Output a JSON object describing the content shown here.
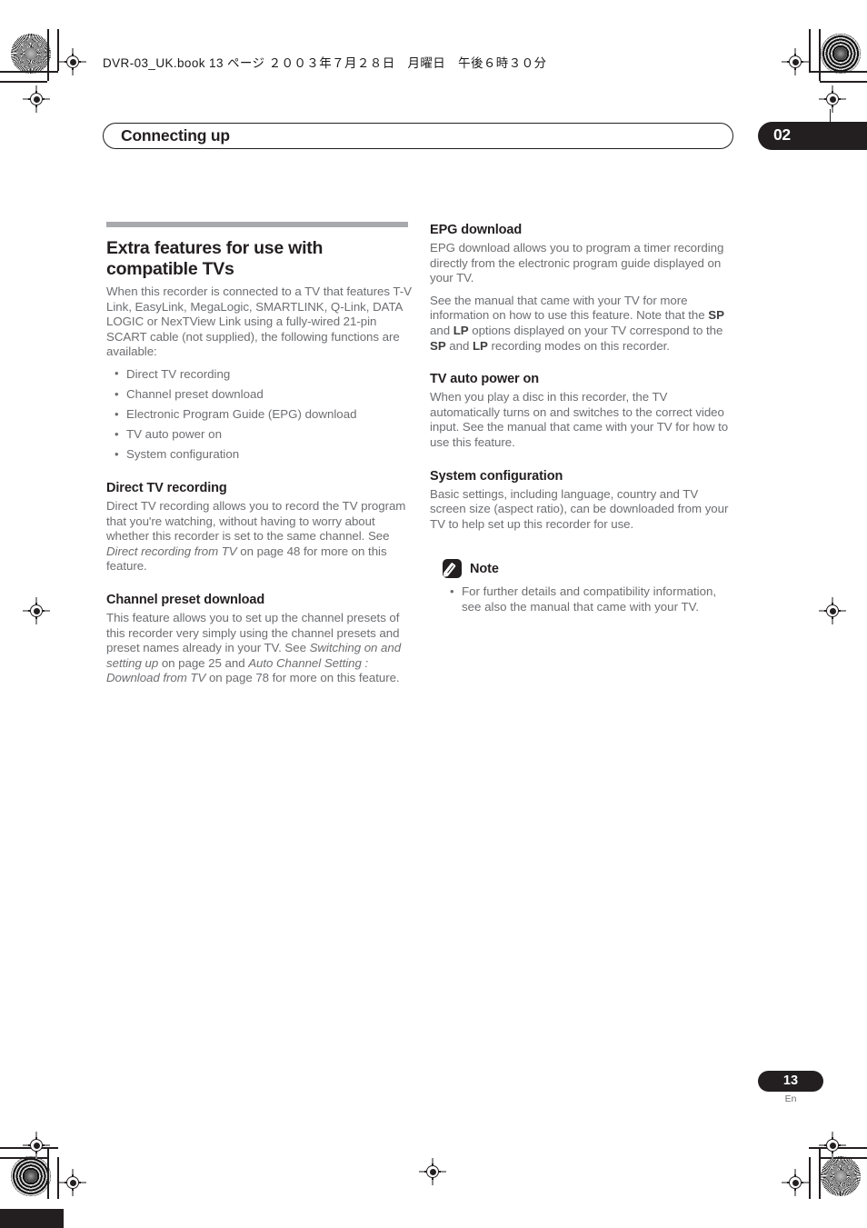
{
  "print_marks": {
    "book_line": "DVR-03_UK.book 13 ページ ２００３年７月２８日　月曜日　午後６時３０分"
  },
  "header": {
    "title": "Connecting up",
    "chapter_number": "02"
  },
  "left_column": {
    "title": "Extra features for use with compatible TVs",
    "intro": "When this recorder is connected to a TV that features T-V Link, EasyLink, MegaLogic, SMARTLINK, Q-Link, DATA LOGIC or NexTView Link using a fully-wired 21-pin SCART cable (not supplied), the following functions are available:",
    "bullets": [
      "Direct TV recording",
      "Channel preset download",
      "Electronic Program Guide (EPG) download",
      "TV auto power on",
      "System configuration"
    ],
    "sections": [
      {
        "heading": "Direct TV recording",
        "body_parts": [
          {
            "text": "Direct TV recording allows you to record the TV program that you're watching, without having to worry about whether this recorder is set to the same channel. See ",
            "style": "normal"
          },
          {
            "text": "Direct recording from TV",
            "style": "italic"
          },
          {
            "text": " on page 48 for more on this feature.",
            "style": "normal"
          }
        ]
      },
      {
        "heading": "Channel preset download",
        "body_parts": [
          {
            "text": "This feature allows you to set up the channel presets of this recorder very simply using the channel presets and preset names already in your TV. See ",
            "style": "normal"
          },
          {
            "text": "Switching on and setting up",
            "style": "italic"
          },
          {
            "text": " on page 25 and ",
            "style": "normal"
          },
          {
            "text": "Auto Channel Setting : Download from TV",
            "style": "italic"
          },
          {
            "text": " on page 78 for more on this feature.",
            "style": "normal"
          }
        ]
      }
    ]
  },
  "right_column": {
    "sections": [
      {
        "heading": "EPG download",
        "paragraphs": [
          [
            {
              "text": "EPG download allows you to program a timer recording directly from the electronic program guide displayed on your TV.",
              "style": "normal"
            }
          ],
          [
            {
              "text": "See the manual that came with your TV for more information on how to use this feature. Note that the ",
              "style": "normal"
            },
            {
              "text": "SP",
              "style": "bold"
            },
            {
              "text": " and ",
              "style": "normal"
            },
            {
              "text": "LP",
              "style": "bold"
            },
            {
              "text": " options displayed on your TV correspond to the ",
              "style": "normal"
            },
            {
              "text": "SP",
              "style": "bold"
            },
            {
              "text": " and ",
              "style": "normal"
            },
            {
              "text": "LP",
              "style": "bold"
            },
            {
              "text": " recording modes on this recorder.",
              "style": "normal"
            }
          ]
        ]
      },
      {
        "heading": "TV auto power on",
        "paragraphs": [
          [
            {
              "text": "When you play a disc in this recorder, the TV automatically turns on and switches to the correct video input. See the manual that came with your TV for how to use this feature.",
              "style": "normal"
            }
          ]
        ]
      },
      {
        "heading": "System configuration",
        "paragraphs": [
          [
            {
              "text": "Basic settings, including language, country and TV screen size (aspect ratio), can be downloaded from your TV to help set up this recorder for use.",
              "style": "normal"
            }
          ]
        ]
      }
    ],
    "note": {
      "label": "Note",
      "icon": "pencil-icon",
      "items": [
        "For further details and compatibility information, see also the manual that came with your TV."
      ]
    }
  },
  "footer": {
    "page_number": "13",
    "language_code": "En"
  },
  "colors": {
    "ink": "#231f20",
    "body_text": "#6d6e71",
    "rule": "#a7a9ac"
  }
}
